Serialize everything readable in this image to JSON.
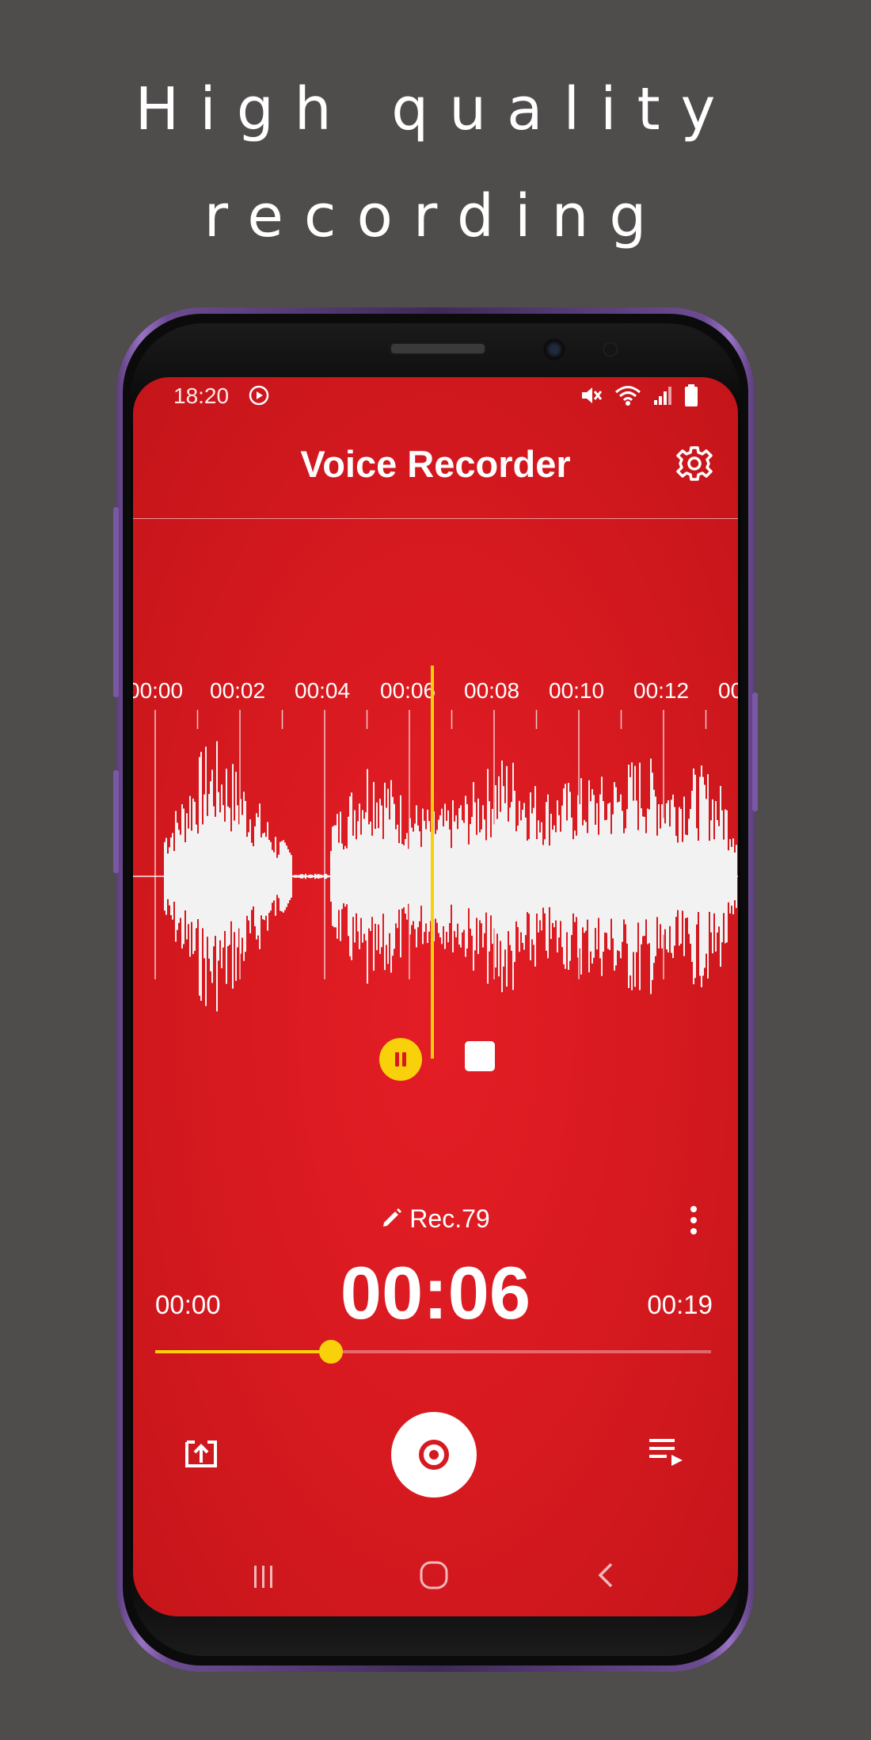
{
  "promo": {
    "line1": "High quality",
    "line2": "recording"
  },
  "status_bar": {
    "time": "18:20"
  },
  "app": {
    "title": "Voice Recorder"
  },
  "timeline": {
    "ticks": [
      "00:00",
      "00:02",
      "00:04",
      "00:06",
      "00:08",
      "00:10",
      "00:12",
      "00"
    ]
  },
  "recording": {
    "name": "Rec.79",
    "current_time": "00:06",
    "start_time": "00:00",
    "end_time": "00:19",
    "progress": 0.316
  },
  "colors": {
    "accent": "#f9d10b",
    "screen_bg": "#d81a20",
    "page_bg": "#4f4c4c"
  },
  "icons": {
    "status": [
      "play-circle-icon",
      "mute-icon",
      "wifi-icon",
      "signal-icon",
      "battery-icon"
    ],
    "settings": "gear-icon",
    "pause": "pause-icon",
    "stop": "stop-icon",
    "edit": "pencil-icon",
    "more": "more-vertical-icon",
    "share": "share-icon",
    "record": "record-icon",
    "playlist": "playlist-icon",
    "nav": [
      "recent-apps-icon",
      "home-icon",
      "back-icon"
    ]
  }
}
